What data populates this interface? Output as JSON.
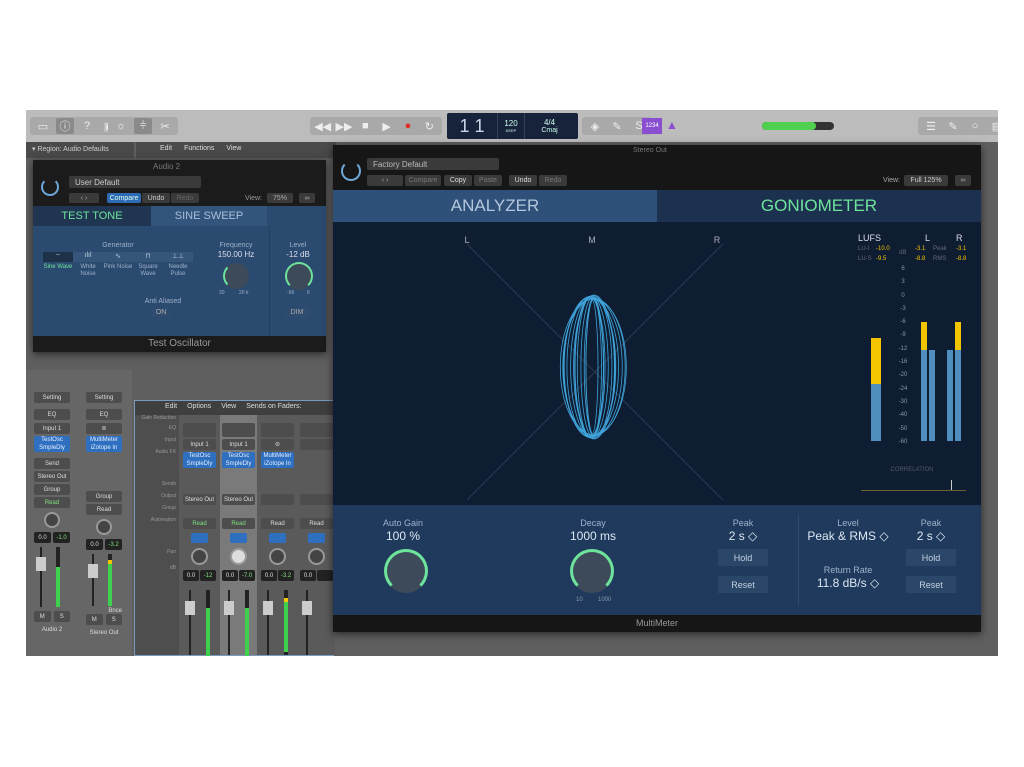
{
  "toolbar": {
    "lcd": {
      "position": "1  1",
      "bar_label": "BAR",
      "beat_label": "BEAT",
      "tempo": "120",
      "keep_label": "KEEP",
      "tempo_label": "TEMPO",
      "signature": "4/4",
      "key": "Cmaj"
    },
    "count_in": "1234",
    "master_volume": 0.7
  },
  "region": {
    "label": "Region:",
    "name": "Audio Defaults"
  },
  "tracks_menu": {
    "edit": "Edit",
    "functions": "Functions",
    "view": "View"
  },
  "test_oscillator": {
    "track": "Audio 2",
    "preset": "User Default",
    "compare": "Compare",
    "undo": "Undo",
    "redo": "Redo",
    "view_label": "View:",
    "view_value": "75%",
    "tabs": [
      "TEST TONE",
      "SINE SWEEP"
    ],
    "generator_label": "Generator",
    "waveforms": [
      {
        "icon": "~",
        "label": "Sine Wave"
      },
      {
        "icon": "ılıl",
        "label": "White Noise"
      },
      {
        "icon": "∿",
        "label": "Pink Noise"
      },
      {
        "icon": "⊓",
        "label": "Square Wave"
      },
      {
        "icon": "⊥⊥",
        "label": "Needle Pulse"
      }
    ],
    "anti_aliased_label": "Anti Aliased",
    "anti_aliased_value": "ON",
    "frequency_label": "Frequency",
    "frequency_value": "150.00 Hz",
    "freq_min": "20",
    "freq_max": "20 k",
    "level_label": "Level",
    "level_value": "-12 dB",
    "level_min": "-96",
    "level_max": "6",
    "dim": "DIM",
    "title": "Test Oscillator"
  },
  "multimeter": {
    "preset": "Factory Default",
    "compare": "Compare",
    "copy": "Copy",
    "paste": "Paste",
    "undo": "Undo",
    "redo": "Redo",
    "view_label": "View:",
    "view_value": "Full 125%",
    "header_text": "Stereo Out",
    "tabs": [
      "ANALYZER",
      "GONIOMETER"
    ],
    "gonio_labels": [
      "L",
      "M",
      "R"
    ],
    "lufs": {
      "title": "LUFS",
      "lu_i_label": "LU-I",
      "lu_i": "-10.0",
      "lu_s_label": "LU-S",
      "lu_s": "-9.5",
      "db_label": "dB"
    },
    "channels": {
      "l": "L",
      "r": "R",
      "peak_label": "Peak",
      "rms_label": "RMS",
      "l_peak": "-3.1",
      "r_peak": "-3.1",
      "l_rms": "-8.8",
      "r_rms": "-8.8"
    },
    "scale": [
      "6",
      "3",
      "0",
      "-3",
      "-6",
      "-9",
      "-12",
      "-16",
      "-20",
      "-24",
      "-30",
      "-40",
      "-50",
      "-60"
    ],
    "correlation_label": "CORRELATION",
    "auto_gain_label": "Auto Gain",
    "auto_gain_value": "100 %",
    "decay_label": "Decay",
    "decay_value": "1000 ms",
    "decay_min": "10",
    "decay_max": "1000",
    "peak_label": "Peak",
    "peak_value": "2 s ◇",
    "hold": "Hold",
    "reset": "Reset",
    "level_label": "Level",
    "level_value": "Peak & RMS ◇",
    "peak2_label": "Peak",
    "peak2_value": "2 s ◇",
    "return_rate_label": "Return Rate",
    "return_rate_value": "11.8 dB/s ◇",
    "hold2": "Hold",
    "reset2": "Reset",
    "title": "MultiMeter"
  },
  "left_channels": [
    {
      "setting": "Setting",
      "eq": "EQ",
      "input": "Input 1",
      "fx": [
        "TestOsc",
        "SmpleDly"
      ],
      "send": "Send",
      "output": "Stereo Out",
      "group": "Group",
      "automation": "Read",
      "vol": "0.0",
      "peak": "-1.0",
      "m": "M",
      "s": "S",
      "name": "Audio 2"
    },
    {
      "setting": "Setting",
      "eq": "EQ",
      "input": "⊜",
      "fx": [
        "MultiMeter",
        "iZotope In"
      ],
      "send": "",
      "output": "",
      "group": "Group",
      "automation": "Read",
      "vol": "0.0",
      "peak": "-3.2",
      "bnce": "Bnce",
      "m": "M",
      "s": "S",
      "name": "Stereo Out"
    }
  ],
  "mixer": {
    "menu": {
      "edit": "Edit",
      "options": "Options",
      "view": "View",
      "sends": "Sends on Faders:"
    },
    "row_labels": [
      "Gain Reduction",
      "EQ",
      "Input",
      "Audio FX",
      "Sends",
      "Output",
      "Group",
      "Automation",
      "Pan",
      "dB"
    ],
    "strips": [
      {
        "input": "Input 1",
        "fx": [
          "TestOsc",
          "SmpleDly"
        ],
        "output": "Stereo Out",
        "automation": "Read",
        "vol": "0.0",
        "peak": "-12"
      },
      {
        "input": "Input 1",
        "fx": [
          "TestOsc",
          "SmpleDly"
        ],
        "output": "Stereo Out",
        "automation": "Read",
        "vol": "0.0",
        "peak": "-7.0"
      },
      {
        "input": "⊜",
        "fx": [
          "MultiMeter",
          "iZotope In"
        ],
        "output": "",
        "automation": "Read",
        "vol": "0.0",
        "peak": "-3.2"
      },
      {
        "input": "",
        "fx": [],
        "output": "",
        "automation": "Read",
        "vol": "0.0",
        "peak": ""
      }
    ]
  },
  "colors": {
    "accent_green": "#6ee39b",
    "meter_blue": "#4f8fc0",
    "meter_yellow": "#f2c500",
    "record": "#e0302a",
    "count_in": "#8a4fd0"
  }
}
